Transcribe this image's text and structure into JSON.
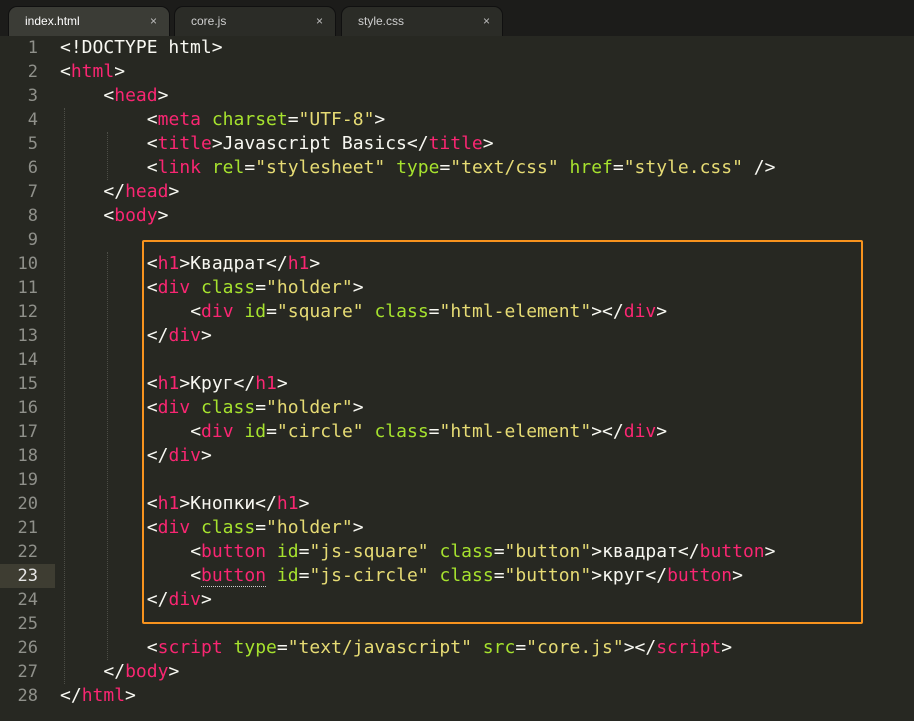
{
  "tabs": [
    {
      "label": "index.html",
      "active": true,
      "close": "×"
    },
    {
      "label": "core.js",
      "active": false,
      "close": "×"
    },
    {
      "label": "style.css",
      "active": false,
      "close": "×"
    }
  ],
  "editor": {
    "current_line": 23,
    "highlight_color": "#f7931e",
    "lines": [
      {
        "n": 1,
        "indent": 0,
        "tokens": [
          [
            "pn",
            "<!DOCTYPE html>"
          ]
        ]
      },
      {
        "n": 2,
        "indent": 0,
        "tokens": [
          [
            "pn",
            "<"
          ],
          [
            "tg",
            "html"
          ],
          [
            "pn",
            ">"
          ]
        ]
      },
      {
        "n": 3,
        "indent": 1,
        "tokens": [
          [
            "pn",
            "<"
          ],
          [
            "tg",
            "head"
          ],
          [
            "pn",
            ">"
          ]
        ]
      },
      {
        "n": 4,
        "indent": 2,
        "tokens": [
          [
            "pn",
            "<"
          ],
          [
            "tg",
            "meta"
          ],
          [
            "pn",
            " "
          ],
          [
            "at",
            "charset"
          ],
          [
            "pn",
            "="
          ],
          [
            "st",
            "\"UTF-8\""
          ],
          [
            "pn",
            ">"
          ]
        ]
      },
      {
        "n": 5,
        "indent": 2,
        "tokens": [
          [
            "pn",
            "<"
          ],
          [
            "tg",
            "title"
          ],
          [
            "pn",
            ">Javascript Basics</"
          ],
          [
            "tg",
            "title"
          ],
          [
            "pn",
            ">"
          ]
        ]
      },
      {
        "n": 6,
        "indent": 2,
        "tokens": [
          [
            "pn",
            "<"
          ],
          [
            "tg",
            "link"
          ],
          [
            "pn",
            " "
          ],
          [
            "at",
            "rel"
          ],
          [
            "pn",
            "="
          ],
          [
            "st",
            "\"stylesheet\""
          ],
          [
            "pn",
            " "
          ],
          [
            "at",
            "type"
          ],
          [
            "pn",
            "="
          ],
          [
            "st",
            "\"text/css\""
          ],
          [
            "pn",
            " "
          ],
          [
            "at",
            "href"
          ],
          [
            "pn",
            "="
          ],
          [
            "st",
            "\"style.css\""
          ],
          [
            "pn",
            " />"
          ]
        ]
      },
      {
        "n": 7,
        "indent": 1,
        "tokens": [
          [
            "pn",
            "</"
          ],
          [
            "tg",
            "head"
          ],
          [
            "pn",
            ">"
          ]
        ]
      },
      {
        "n": 8,
        "indent": 1,
        "tokens": [
          [
            "pn",
            "<"
          ],
          [
            "tg",
            "body"
          ],
          [
            "pn",
            ">"
          ]
        ]
      },
      {
        "n": 9,
        "indent": 0,
        "tokens": []
      },
      {
        "n": 10,
        "indent": 2,
        "tokens": [
          [
            "pn",
            "<"
          ],
          [
            "tg",
            "h1"
          ],
          [
            "pn",
            ">Квадрат</"
          ],
          [
            "tg",
            "h1"
          ],
          [
            "pn",
            ">"
          ]
        ]
      },
      {
        "n": 11,
        "indent": 2,
        "tokens": [
          [
            "pn",
            "<"
          ],
          [
            "tg",
            "div"
          ],
          [
            "pn",
            " "
          ],
          [
            "at",
            "class"
          ],
          [
            "pn",
            "="
          ],
          [
            "st",
            "\"holder\""
          ],
          [
            "pn",
            ">"
          ]
        ]
      },
      {
        "n": 12,
        "indent": 3,
        "tokens": [
          [
            "pn",
            "<"
          ],
          [
            "tg",
            "div"
          ],
          [
            "pn",
            " "
          ],
          [
            "at",
            "id"
          ],
          [
            "pn",
            "="
          ],
          [
            "st",
            "\"square\""
          ],
          [
            "pn",
            " "
          ],
          [
            "at",
            "class"
          ],
          [
            "pn",
            "="
          ],
          [
            "st",
            "\"html-element\""
          ],
          [
            "pn",
            "></"
          ],
          [
            "tg",
            "div"
          ],
          [
            "pn",
            ">"
          ]
        ]
      },
      {
        "n": 13,
        "indent": 2,
        "tokens": [
          [
            "pn",
            "</"
          ],
          [
            "tg",
            "div"
          ],
          [
            "pn",
            ">"
          ]
        ]
      },
      {
        "n": 14,
        "indent": 0,
        "tokens": []
      },
      {
        "n": 15,
        "indent": 2,
        "tokens": [
          [
            "pn",
            "<"
          ],
          [
            "tg",
            "h1"
          ],
          [
            "pn",
            ">Круг</"
          ],
          [
            "tg",
            "h1"
          ],
          [
            "pn",
            ">"
          ]
        ]
      },
      {
        "n": 16,
        "indent": 2,
        "tokens": [
          [
            "pn",
            "<"
          ],
          [
            "tg",
            "div"
          ],
          [
            "pn",
            " "
          ],
          [
            "at",
            "class"
          ],
          [
            "pn",
            "="
          ],
          [
            "st",
            "\"holder\""
          ],
          [
            "pn",
            ">"
          ]
        ]
      },
      {
        "n": 17,
        "indent": 3,
        "tokens": [
          [
            "pn",
            "<"
          ],
          [
            "tg",
            "div"
          ],
          [
            "pn",
            " "
          ],
          [
            "at",
            "id"
          ],
          [
            "pn",
            "="
          ],
          [
            "st",
            "\"circle\""
          ],
          [
            "pn",
            " "
          ],
          [
            "at",
            "class"
          ],
          [
            "pn",
            "="
          ],
          [
            "st",
            "\"html-element\""
          ],
          [
            "pn",
            "></"
          ],
          [
            "tg",
            "div"
          ],
          [
            "pn",
            ">"
          ]
        ]
      },
      {
        "n": 18,
        "indent": 2,
        "tokens": [
          [
            "pn",
            "</"
          ],
          [
            "tg",
            "div"
          ],
          [
            "pn",
            ">"
          ]
        ]
      },
      {
        "n": 19,
        "indent": 0,
        "tokens": []
      },
      {
        "n": 20,
        "indent": 2,
        "tokens": [
          [
            "pn",
            "<"
          ],
          [
            "tg",
            "h1"
          ],
          [
            "pn",
            ">Кнопки</"
          ],
          [
            "tg",
            "h1"
          ],
          [
            "pn",
            ">"
          ]
        ]
      },
      {
        "n": 21,
        "indent": 2,
        "tokens": [
          [
            "pn",
            "<"
          ],
          [
            "tg",
            "div"
          ],
          [
            "pn",
            " "
          ],
          [
            "at",
            "class"
          ],
          [
            "pn",
            "="
          ],
          [
            "st",
            "\"holder\""
          ],
          [
            "pn",
            ">"
          ]
        ]
      },
      {
        "n": 22,
        "indent": 3,
        "tokens": [
          [
            "pn",
            "<"
          ],
          [
            "tg",
            "button"
          ],
          [
            "pn",
            " "
          ],
          [
            "at",
            "id"
          ],
          [
            "pn",
            "="
          ],
          [
            "st",
            "\"js-square\""
          ],
          [
            "pn",
            " "
          ],
          [
            "at",
            "class"
          ],
          [
            "pn",
            "="
          ],
          [
            "st",
            "\"button\""
          ],
          [
            "pn",
            ">квадрат</"
          ],
          [
            "tg",
            "button"
          ],
          [
            "pn",
            ">"
          ]
        ]
      },
      {
        "n": 23,
        "indent": 3,
        "tokens": [
          [
            "pn",
            "<"
          ],
          [
            "tg",
            "button"
          ],
          [
            "pn",
            " "
          ],
          [
            "at",
            "id"
          ],
          [
            "pn",
            "="
          ],
          [
            "st",
            "\"js-circle\""
          ],
          [
            "pn",
            " "
          ],
          [
            "at",
            "class"
          ],
          [
            "pn",
            "="
          ],
          [
            "st",
            "\"button\""
          ],
          [
            "pn",
            ">круг</"
          ],
          [
            "tg",
            "button"
          ],
          [
            "pn",
            ">"
          ]
        ]
      },
      {
        "n": 24,
        "indent": 2,
        "tokens": [
          [
            "pn",
            "</"
          ],
          [
            "tg",
            "div"
          ],
          [
            "pn",
            ">"
          ]
        ]
      },
      {
        "n": 25,
        "indent": 0,
        "tokens": []
      },
      {
        "n": 26,
        "indent": 2,
        "tokens": [
          [
            "pn",
            "<"
          ],
          [
            "tg",
            "script"
          ],
          [
            "pn",
            " "
          ],
          [
            "at",
            "type"
          ],
          [
            "pn",
            "="
          ],
          [
            "st",
            "\"text/javascript\""
          ],
          [
            "pn",
            " "
          ],
          [
            "at",
            "src"
          ],
          [
            "pn",
            "="
          ],
          [
            "st",
            "\"core.js\""
          ],
          [
            "pn",
            "></"
          ],
          [
            "tg",
            "script"
          ],
          [
            "pn",
            ">"
          ]
        ]
      },
      {
        "n": 27,
        "indent": 1,
        "tokens": [
          [
            "pn",
            "</"
          ],
          [
            "tg",
            "body"
          ],
          [
            "pn",
            ">"
          ]
        ]
      },
      {
        "n": 28,
        "indent": 0,
        "tokens": [
          [
            "pn",
            "</"
          ],
          [
            "tg",
            "html"
          ],
          [
            "pn",
            ">"
          ]
        ]
      }
    ]
  }
}
